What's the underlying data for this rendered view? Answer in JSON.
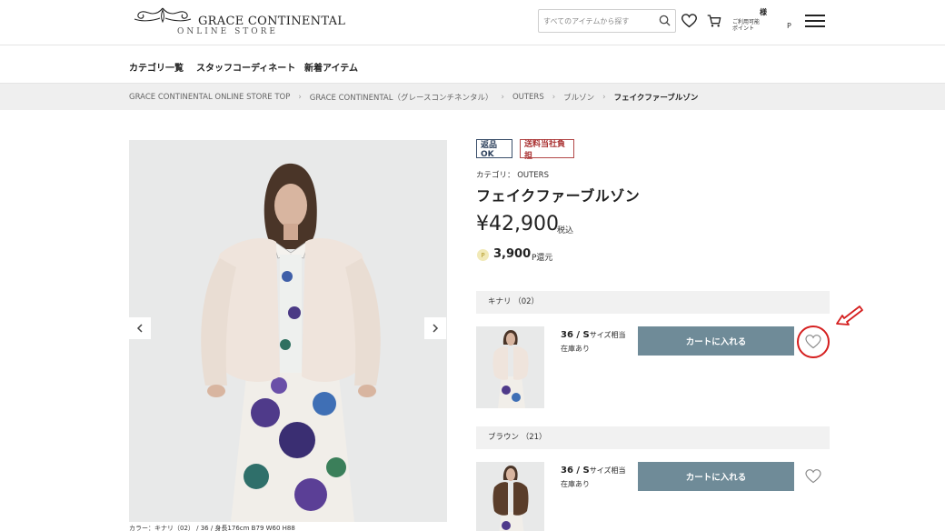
{
  "brand": {
    "title": "GRACE CONTINENTAL",
    "subtitle": "ONLINE STORE"
  },
  "header": {
    "search_placeholder": "すべてのアイテムから探す",
    "user_suffix": "様",
    "points_label_line1": "ご利用可能",
    "points_label_line2": "ポイント",
    "points_unit": "P"
  },
  "nav": {
    "items": [
      "カテゴリ一覧",
      "スタッフコーディネート",
      "新着アイテム"
    ]
  },
  "breadcrumb": {
    "items": [
      "GRACE CONTINENTAL ONLINE STORE TOP",
      "GRACE CONTINENTAL（グレースコンチネンタル）",
      "OUTERS",
      "ブルゾン",
      "フェイクファーブルゾン"
    ]
  },
  "product": {
    "badges": [
      "返品OK",
      "送料当社負担"
    ],
    "category": "カテゴリ： OUTERS",
    "name": "フェイクファーブルゾン",
    "price": "¥42,900",
    "tax_label": "税込",
    "points_icon": "P",
    "points_value": "3,900",
    "points_unit": "P還元",
    "image_caption": "カラー：キナリ（02） / 36 / 身長176cm B79 W60 H88",
    "variants": [
      {
        "color_label": "キナリ （02）",
        "size": "36 / S",
        "size_note": "サイズ相当",
        "stock": "在庫あり",
        "cart_label": "カートに入れる"
      },
      {
        "color_label": "ブラウン （21）",
        "size": "36 / S",
        "size_note": "サイズ相当",
        "stock": "在庫あり",
        "cart_label": "カートに入れる"
      }
    ]
  },
  "colors": {
    "cart_button": "#6f8b98",
    "annotation": "#d51f1f",
    "badge_blue": "#2c405c",
    "badge_red": "#a33333"
  }
}
